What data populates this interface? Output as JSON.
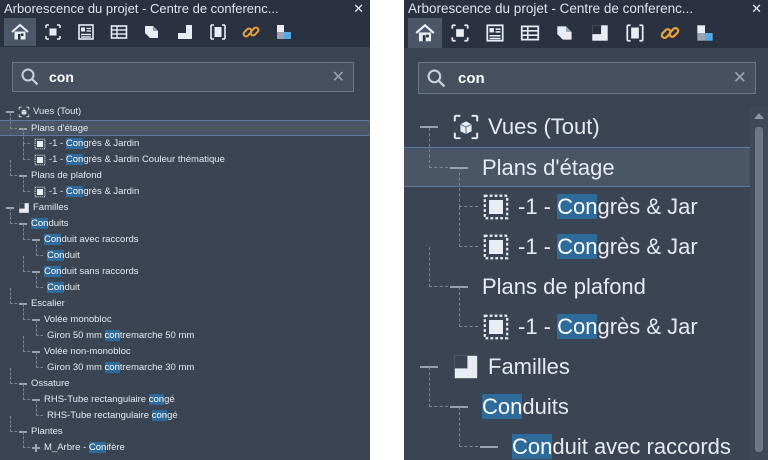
{
  "window": {
    "title": "Arborescence du projet - Centre de conferenc...",
    "close_symbol": "✕"
  },
  "toolbar": {
    "buttons": [
      {
        "icon": "home-icon",
        "active": true
      },
      {
        "icon": "views-icon"
      },
      {
        "icon": "sheets-icon"
      },
      {
        "icon": "schedule-icon"
      },
      {
        "icon": "materials-icon"
      },
      {
        "icon": "layouts-icon"
      },
      {
        "icon": "groups-icon"
      },
      {
        "icon": "links-icon"
      },
      {
        "icon": "assemblies-icon"
      }
    ]
  },
  "search": {
    "value": "con",
    "clear_symbol": "✕"
  },
  "tree_left": [
    {
      "depth": 0,
      "exp": "minus",
      "icon": "view-cube-icon",
      "parts": [
        {
          "t": "Vues (Tout)"
        }
      ]
    },
    {
      "depth": 1,
      "exp": "minus",
      "selected": true,
      "parts": [
        {
          "t": "Plans d'étage"
        }
      ]
    },
    {
      "depth": 2,
      "icon": "floor-plan-icon",
      "parts": [
        {
          "t": "-1 - "
        },
        {
          "t": "Con",
          "hl": true
        },
        {
          "t": "grès & Jardin"
        }
      ]
    },
    {
      "depth": 2,
      "icon": "floor-plan-icon",
      "parts": [
        {
          "t": "-1 - "
        },
        {
          "t": "Con",
          "hl": true
        },
        {
          "t": "grès & Jardin Couleur thématique"
        }
      ]
    },
    {
      "depth": 1,
      "exp": "minus",
      "parts": [
        {
          "t": "Plans de plafond"
        }
      ]
    },
    {
      "depth": 2,
      "icon": "floor-plan-icon",
      "parts": [
        {
          "t": "-1 - "
        },
        {
          "t": "Con",
          "hl": true
        },
        {
          "t": "grès & Jardin"
        }
      ]
    },
    {
      "depth": 0,
      "exp": "minus",
      "icon": "families-icon",
      "parts": [
        {
          "t": "Familles"
        }
      ]
    },
    {
      "depth": 1,
      "exp": "minus",
      "parts": [
        {
          "t": "Con",
          "hl": true
        },
        {
          "t": "duits"
        }
      ]
    },
    {
      "depth": 2,
      "exp": "minus",
      "parts": [
        {
          "t": "Con",
          "hl": true
        },
        {
          "t": "duit avec raccords"
        }
      ]
    },
    {
      "depth": 3,
      "parts": [
        {
          "t": "Con",
          "hl": true
        },
        {
          "t": "duit"
        }
      ]
    },
    {
      "depth": 2,
      "exp": "minus",
      "parts": [
        {
          "t": "Con",
          "hl": true
        },
        {
          "t": "duit sans raccords"
        }
      ]
    },
    {
      "depth": 3,
      "parts": [
        {
          "t": "Con",
          "hl": true
        },
        {
          "t": "duit"
        }
      ]
    },
    {
      "depth": 1,
      "exp": "minus",
      "parts": [
        {
          "t": "Escalier"
        }
      ]
    },
    {
      "depth": 2,
      "exp": "minus",
      "parts": [
        {
          "t": "Volée monobloc"
        }
      ]
    },
    {
      "depth": 3,
      "parts": [
        {
          "t": "Giron 50 mm "
        },
        {
          "t": "con",
          "hl": true
        },
        {
          "t": "tremarche 50 mm"
        }
      ]
    },
    {
      "depth": 2,
      "exp": "minus",
      "parts": [
        {
          "t": "Volée non-monobloc"
        }
      ]
    },
    {
      "depth": 3,
      "parts": [
        {
          "t": "Giron 30 mm "
        },
        {
          "t": "con",
          "hl": true
        },
        {
          "t": "tremarche 30 mm"
        }
      ]
    },
    {
      "depth": 1,
      "exp": "minus",
      "parts": [
        {
          "t": "Ossature"
        }
      ]
    },
    {
      "depth": 2,
      "exp": "minus",
      "parts": [
        {
          "t": "RHS-Tube rectangulaire "
        },
        {
          "t": "con",
          "hl": true
        },
        {
          "t": "gé"
        }
      ]
    },
    {
      "depth": 3,
      "parts": [
        {
          "t": "RHS-Tube rectangulaire "
        },
        {
          "t": "con",
          "hl": true
        },
        {
          "t": "gé"
        }
      ]
    },
    {
      "depth": 1,
      "exp": "minus",
      "parts": [
        {
          "t": "Plantes"
        }
      ]
    },
    {
      "depth": 2,
      "exp": "plus",
      "parts": [
        {
          "t": "M_Arbre - "
        },
        {
          "t": "Con",
          "hl": true
        },
        {
          "t": "ifère"
        }
      ]
    }
  ],
  "tree_right": [
    {
      "depth": 0,
      "exp": "minus",
      "icon": "view-cube-icon",
      "parts": [
        {
          "t": "Vues (Tout)"
        }
      ]
    },
    {
      "depth": 1,
      "exp": "minus",
      "selected": true,
      "parts": [
        {
          "t": "Plans d'étage"
        }
      ]
    },
    {
      "depth": 2,
      "icon": "floor-plan-icon",
      "parts": [
        {
          "t": "-1 - "
        },
        {
          "t": "Con",
          "hl": true
        },
        {
          "t": "grès & Jar"
        }
      ]
    },
    {
      "depth": 2,
      "icon": "floor-plan-icon",
      "parts": [
        {
          "t": "-1 - "
        },
        {
          "t": "Con",
          "hl": true
        },
        {
          "t": "grès & Jar"
        }
      ]
    },
    {
      "depth": 1,
      "exp": "minus",
      "parts": [
        {
          "t": "Plans de plafond"
        }
      ]
    },
    {
      "depth": 2,
      "icon": "floor-plan-icon",
      "parts": [
        {
          "t": "-1 - "
        },
        {
          "t": "Con",
          "hl": true
        },
        {
          "t": "grès & Jar"
        }
      ]
    },
    {
      "depth": 0,
      "exp": "minus",
      "icon": "families-icon",
      "parts": [
        {
          "t": "Familles"
        }
      ]
    },
    {
      "depth": 1,
      "exp": "minus",
      "parts": [
        {
          "t": "Con",
          "hl": true
        },
        {
          "t": "duits"
        }
      ]
    },
    {
      "depth": 2,
      "exp": "minus",
      "parts": [
        {
          "t": "Con",
          "hl": true
        },
        {
          "t": "duit avec raccords"
        }
      ]
    }
  ],
  "colors": {
    "panel_bg": "#3b4453",
    "titlebar_bg": "#2a3140",
    "highlight": "#2f6b9a",
    "selected_row": "#4a5566",
    "text": "#e6eaf0"
  }
}
